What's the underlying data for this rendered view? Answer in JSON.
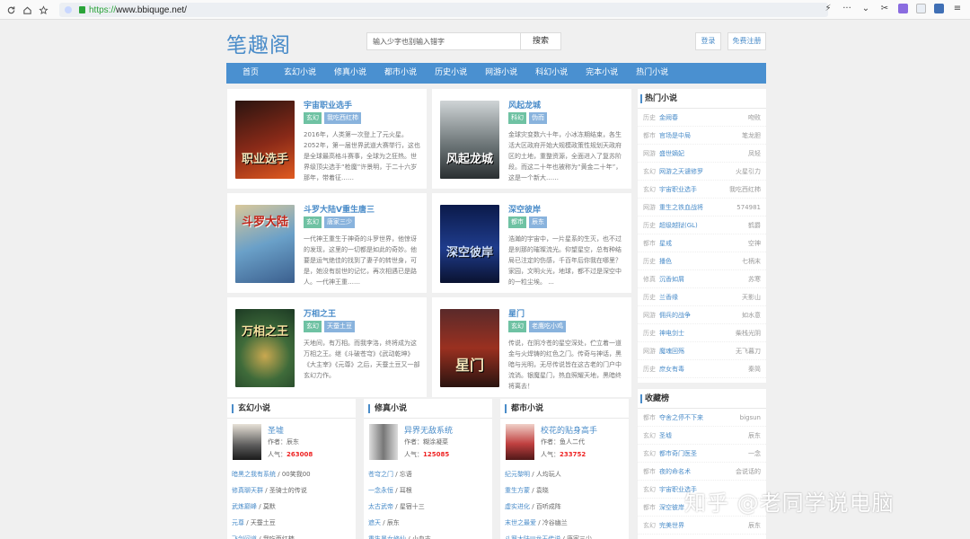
{
  "browser": {
    "url_scheme": "https://",
    "url_host": "www.bbiquge.net/"
  },
  "site": {
    "logo": "笔趣阁",
    "search_placeholder": "输入少字也别输入错字",
    "search_button": "搜索",
    "login": "登录",
    "register": "免费注册"
  },
  "nav": [
    "首页",
    "玄幻小说",
    "修真小说",
    "都市小说",
    "历史小说",
    "网游小说",
    "科幻小说",
    "完本小说",
    "热门小说"
  ],
  "featured": [
    {
      "title": "宇宙职业选手",
      "tags": [
        "玄幻",
        "我吃西红柿"
      ],
      "cover_text": "职业选手",
      "desc": "2016年，人类第一次登上了元火星。2052年，第一届世界武道大赛举行，这也是全球最高格斗赛事，全球为之狂热。世界级顶尖选手“枪魔”许景明，于二十六岁那年，带着征……"
    },
    {
      "title": "风起龙城",
      "tags": [
        "科幻",
        "伪而"
      ],
      "cover_text": "风起龙城",
      "desc": "金球灾变数六十年，小冰冻期结束，各生活大区政府开始大规模政策性规划天政府区的土地，重整资源，全面进入了复苏阶段。而这二十年也被称为“黄金二十年”，这是一个新大……"
    },
    {
      "title": "斗罗大陆V重生唐三",
      "tags": [
        "玄幻",
        "唐家三少"
      ],
      "cover_text": "斗罗大陆",
      "desc": "一代神王重生于神奇的斗罗世界，他惊讶的发现，这里的一切都是如此的奇妙。他要是运气绝佳的找到了妻子的转世身，可是，她没有前世的记忆，再次相遇已是路人。一代神王重……"
    },
    {
      "title": "深空彼岸",
      "tags": [
        "都市",
        "辰东"
      ],
      "cover_text": "深空彼岸",
      "desc": "浩瀚的宇宙中，一片星系的生灭，也不过是刹那的璀璨流光。仰望星空，总有种结局已注定的伤感，千百年后你我在哪里？家园，文明火光，地球，都不过是深空中的一粒尘埃。 ..."
    },
    {
      "title": "万相之王",
      "tags": [
        "玄幻",
        "天蚕土豆"
      ],
      "cover_text": "万相之王",
      "desc": "天地间，有万相。而我李洛，终将成为这万相之王。继《斗破苍穹》《武动乾坤》《大主宰》《元尊》之后，天蚕土豆又一部玄幻力作。"
    },
    {
      "title": "星门",
      "tags": [
        "玄幻",
        "老鹰吃小鸡"
      ],
      "cover_text": "星门",
      "desc": "传说，在阴冷苍的星空深处，伫立着一道金与火焊铸的红色之门。传奇与神话，黑暗与光明，无尽传说皆在这古老的门户中流淌。银魔星门，热血照耀天地，黑暗终将离去！"
    }
  ],
  "hot": {
    "title": "热门小说",
    "items": [
      {
        "cat": "历史",
        "title": "金阙春",
        "author": "吻败"
      },
      {
        "cat": "都市",
        "title": "官场是中局",
        "author": "笔龙胆"
      },
      {
        "cat": "网游",
        "title": "盛世嫡妃",
        "author": "凤轻"
      },
      {
        "cat": "玄幻",
        "title": "网游之天谴修罗",
        "author": "火星引力"
      },
      {
        "cat": "玄幻",
        "title": "宇宙职业选手",
        "author": "我吃西红柿"
      },
      {
        "cat": "网游",
        "title": "重生之铁血战将",
        "author": "574981"
      },
      {
        "cat": "历史",
        "title": "超级越狱(GL)",
        "author": "鹤爵"
      },
      {
        "cat": "都市",
        "title": "星戒",
        "author": "空神"
      },
      {
        "cat": "历史",
        "title": "播色",
        "author": "七柄末"
      },
      {
        "cat": "修真",
        "title": "沉香如屑",
        "author": "苏寒"
      },
      {
        "cat": "历史",
        "title": "兰香缘",
        "author": "天影山"
      },
      {
        "cat": "网游",
        "title": "佣兵的战争",
        "author": "如水意"
      },
      {
        "cat": "历史",
        "title": "神电剑士",
        "author": "柴栈光阴"
      },
      {
        "cat": "网游",
        "title": "魔魂回殇",
        "author": "无飞暮刀"
      },
      {
        "cat": "历史",
        "title": "庶女有毒",
        "author": "秦简"
      }
    ]
  },
  "fav": {
    "title": "收藏榜",
    "items": [
      {
        "cat": "都市",
        "title": "夺舍之停不下来",
        "author": "bigsun"
      },
      {
        "cat": "玄幻",
        "title": "圣墟",
        "author": "辰东"
      },
      {
        "cat": "玄幻",
        "title": "都市奇门医圣",
        "author": "一念"
      },
      {
        "cat": "都市",
        "title": "夜的命名术",
        "author": "会说话的"
      },
      {
        "cat": "玄幻",
        "title": "宇宙职业选手",
        "author": ""
      },
      {
        "cat": "都市",
        "title": "深空彼岸",
        "author": ""
      },
      {
        "cat": "玄幻",
        "title": "完美世界",
        "author": "辰东"
      }
    ]
  },
  "panels": [
    {
      "title": "玄幻小说",
      "book": "圣墟",
      "author_label": "作者：",
      "author": "辰东",
      "pop_label": "人气：",
      "pop": "263008",
      "list": [
        [
          "暗黑之我有系统",
          "00笑我00"
        ],
        [
          "修真聊天群",
          "圣骑士的传说"
        ],
        [
          "武炼巅峰",
          "莫默"
        ],
        [
          "元尊",
          "天蚕土豆"
        ],
        [
          "飞剑问道",
          "我吃西红柿"
        ]
      ]
    },
    {
      "title": "修真小说",
      "book": "异界无敌系统",
      "author_label": "作者：",
      "author": "糊涂凝菜",
      "pop_label": "人气：",
      "pop": "125085",
      "list": [
        [
          "苍穹之门",
          "忘语"
        ],
        [
          "一念永恒",
          "耳根"
        ],
        [
          "太古武帝",
          "星宿十三"
        ],
        [
          "遮天",
          "辰东"
        ],
        [
          "重生暴女修仙",
          "小血吉"
        ]
      ]
    },
    {
      "title": "都市小说",
      "book": "校花的贴身高手",
      "author_label": "作者：",
      "author": "鱼人二代",
      "pop_label": "人气：",
      "pop": "233752",
      "list": [
        [
          "纪元黎明",
          "人均玩人"
        ],
        [
          "重生方蒙",
          "袁晓"
        ],
        [
          "虚实进化",
          "百听成阵"
        ],
        [
          "末世之最爱",
          "冷谷幽兰"
        ],
        [
          "斗罗大陆III龙王传说",
          "唐家三少"
        ]
      ]
    }
  ],
  "watermark": "知乎 @老同学说电脑"
}
